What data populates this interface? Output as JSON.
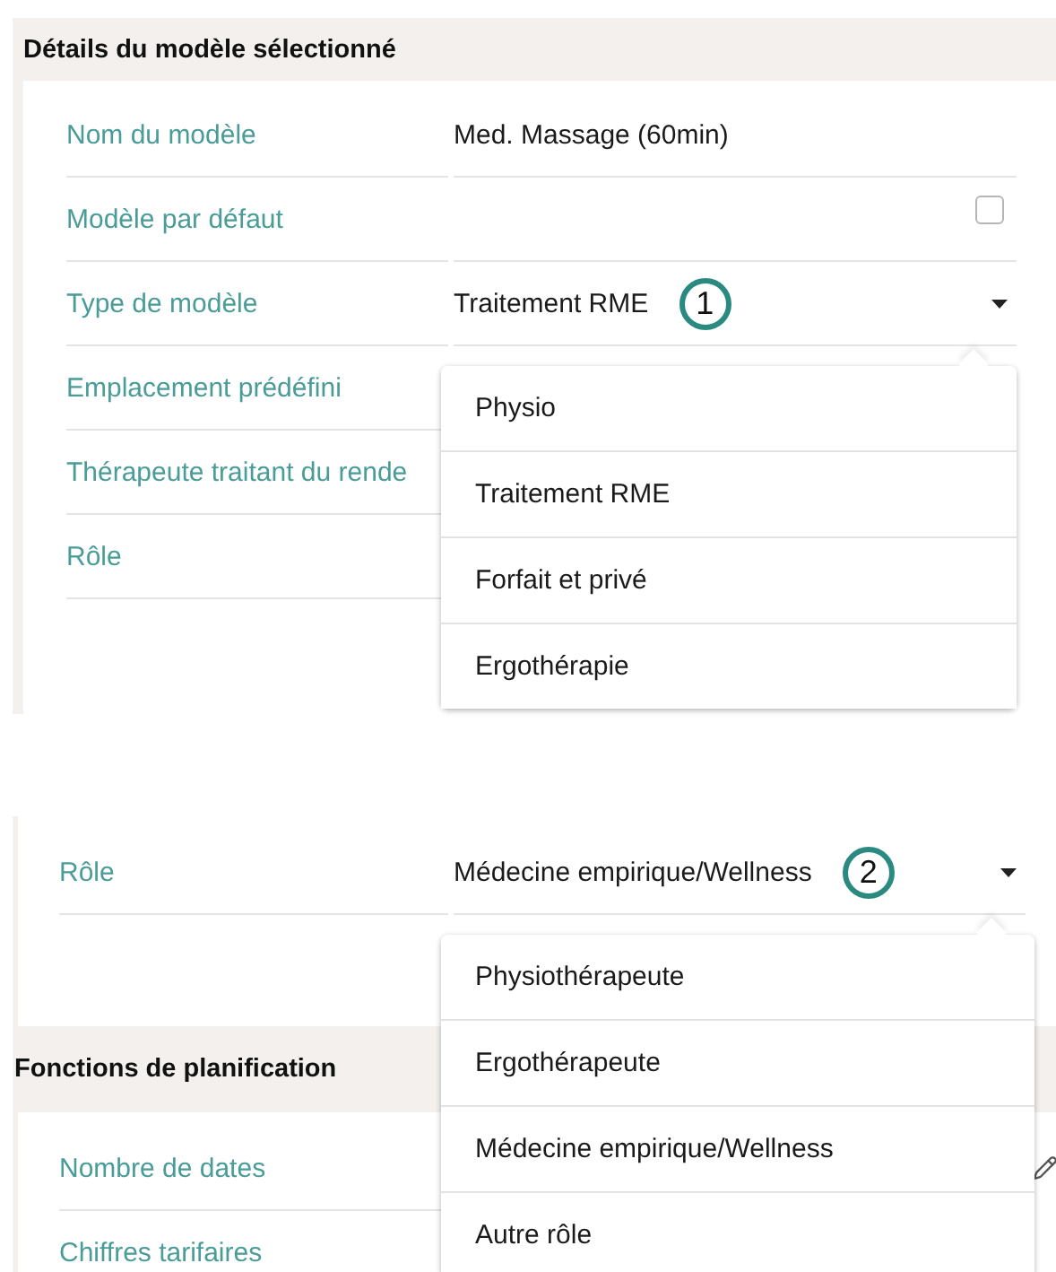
{
  "panels": [
    {
      "groups": [
        {
          "title": "Détails du modèle sélectionné",
          "fields": [
            {
              "kind": "text",
              "label": "Nom du modèle",
              "value": "Med. Massage (60min)"
            },
            {
              "kind": "checkbox",
              "label": "Modèle par défaut",
              "checked": false
            },
            {
              "kind": "select",
              "label": "Type de modèle",
              "value": "Traitement RME",
              "callout": "1",
              "expanded": true,
              "options": [
                "Physio",
                "Traitement RME",
                "Forfait et privé",
                "Ergothérapie"
              ]
            },
            {
              "kind": "text",
              "label": "Emplacement prédéfini"
            },
            {
              "kind": "text",
              "label": "Thérapeute traitant du rende"
            },
            {
              "kind": "text",
              "label": "Rôle"
            }
          ]
        }
      ]
    },
    {
      "groups": [
        {
          "fields": [
            {
              "kind": "select",
              "label": "Rôle",
              "value": "Médecine empirique/Wellness",
              "callout": "2",
              "expanded": true,
              "options": [
                "Physiothérapeute",
                "Ergothérapeute",
                "Médecine empirique/Wellness",
                "Autre rôle"
              ]
            }
          ]
        },
        {
          "title": "Fonctions de planification",
          "fields": [
            {
              "kind": "editable",
              "label": "Nombre de dates"
            },
            {
              "kind": "text",
              "label": "Chiffres tarifaires"
            }
          ]
        }
      ]
    }
  ]
}
